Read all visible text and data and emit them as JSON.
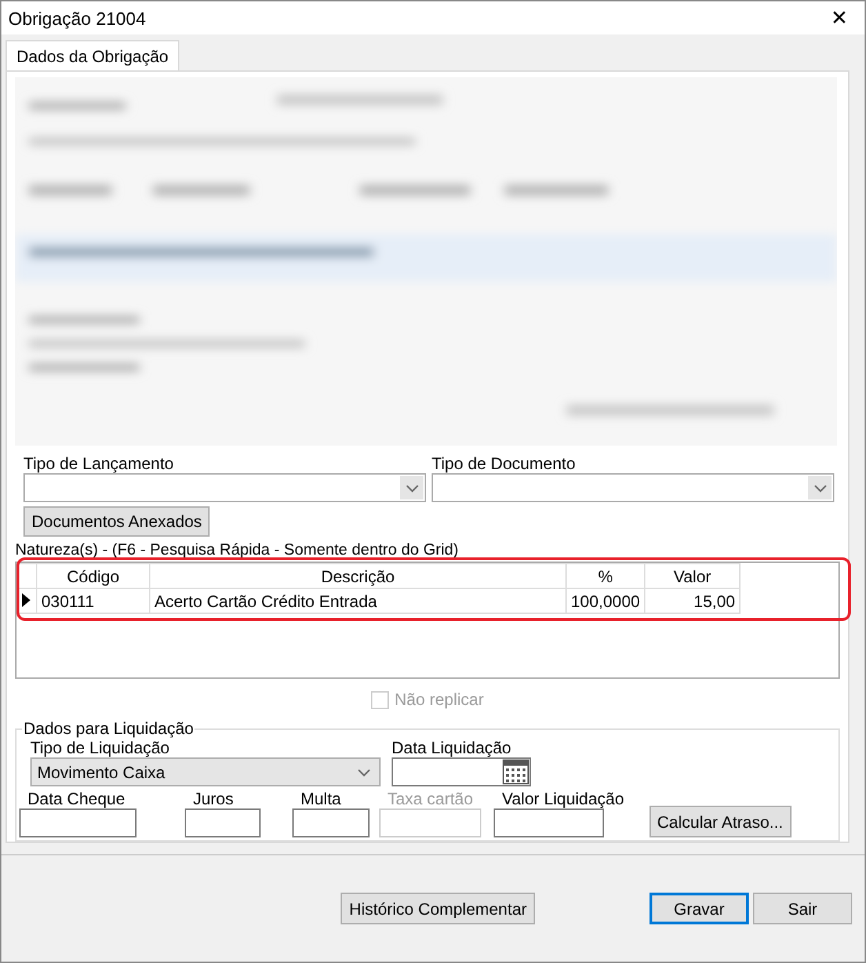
{
  "window": {
    "title": "Obrigação 21004",
    "close": "✕"
  },
  "tabs": [
    {
      "label": "Dados da Obrigação",
      "selected": true
    }
  ],
  "tipo_lancamento": {
    "label": "Tipo de Lançamento"
  },
  "tipo_documento": {
    "label": "Tipo de Documento"
  },
  "documentos_button": "Documentos Anexados",
  "naturezas": {
    "caption": "Natureza(s) - (F6 - Pesquisa Rápida - Somente dentro do Grid)",
    "highlighted": true,
    "columns": [
      "Código",
      "Descrição",
      "%",
      "Valor"
    ],
    "rows": [
      {
        "cells": [
          "030111",
          "Acerto Cartão Crédito Entrada",
          "100,0000",
          "15,00"
        ],
        "selected": true
      }
    ]
  },
  "nao_replicar": {
    "label": "Não replicar",
    "checked": false,
    "disabled": true
  },
  "liquidacao": {
    "title": "Dados para Liquidação",
    "tipo": {
      "label": "Tipo de Liquidação",
      "value": "Movimento Caixa"
    },
    "data_liquidacao": {
      "label": "Data Liquidação"
    },
    "fields": [
      {
        "label": "Data Cheque",
        "disabled": false
      },
      {
        "label": "Juros",
        "disabled": false
      },
      {
        "label": "Multa",
        "disabled": false
      },
      {
        "label": "Taxa cartão",
        "disabled": true
      },
      {
        "label": "Valor Liquidação",
        "disabled": false
      }
    ],
    "calc_button": "Calcular Atraso..."
  },
  "buttons": [
    {
      "label": "Histórico Complementar",
      "default": false
    },
    {
      "label": "Gravar",
      "default": true
    },
    {
      "label": "Sair",
      "default": false
    }
  ]
}
